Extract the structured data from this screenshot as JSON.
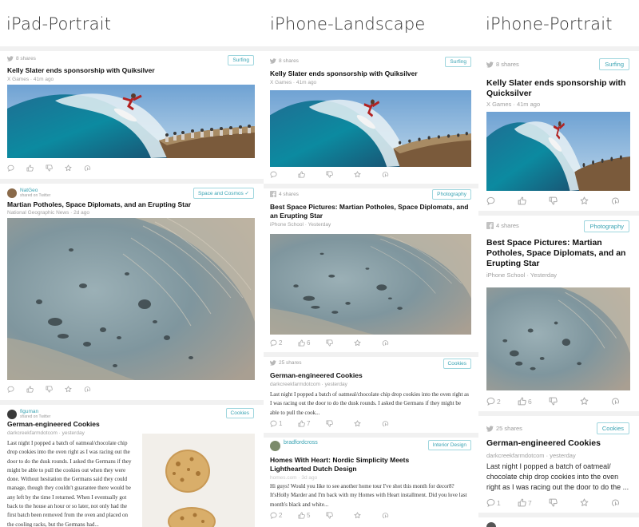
{
  "titles": {
    "ipad": "iPad-Portrait",
    "landscape": "iPhone-Landscape",
    "portrait": "iPhone-Portrait"
  },
  "ipad": {
    "card1": {
      "shares": "8 shares",
      "tag": "Surfing",
      "headline": "Kelly Slater ends sponsorship with Quiksilver",
      "source": "X Games",
      "time": "41m ago"
    },
    "card2": {
      "user": "NatGeo",
      "user_sub": "shared on Twitter",
      "tag": "Space and Cosmos",
      "headline": "Martian Potholes, Space Diplomats, and an Erupting Star",
      "source": "National Geographic News",
      "time": "2d ago"
    },
    "card3": {
      "user": "figuman",
      "user_sub": "shared on Twitter",
      "tag": "Cookies",
      "headline": "German-engineered Cookies",
      "source": "darkcreekfarmdotcom",
      "time": "yesterday",
      "excerpt": "Last night I popped a batch of oatmeal/chocolate chip drop cookies into the oven right as I was racing out the door to do the dusk rounds. I asked the Germans if they might be able to pull the cookies out when they were done. Without hesitation the Germans said they could manage, though they couldn't guarantee there would be any left by the time I returned. When I eventually got back to the house an hour or so later, not only had the first batch been removed from the oven and placed on the cooling racks, but the Germans had..."
    }
  },
  "landscape": {
    "card1": {
      "shares": "8 shares",
      "tag": "Surfing",
      "headline": "Kelly Slater ends sponsorship with Quiksilver",
      "source": "X Games",
      "time": "41m ago"
    },
    "card2": {
      "shares": "4 shares",
      "tag": "Photography",
      "headline": "Best Space Pictures: Martian Potholes, Space Diplomats, and an Erupting Star",
      "source": "iPhone School",
      "time": "Yesterday",
      "comments": "2",
      "likes": "6"
    },
    "card3": {
      "shares": "25 shares",
      "tag": "Cookies",
      "headline": "German-engineered Cookies",
      "source": "darkcreekfarmdotcom",
      "time": "yesterday",
      "excerpt": "Last night I popped a batch of oatmeal/chocolate chip drop cookies into the oven right as I was racing out the door to do the dusk rounds. I asked the Germans if they might be able to pull the cook...",
      "comments": "1",
      "likes": "7"
    },
    "card4": {
      "user": "bradfordcross",
      "tag": "Interior Design",
      "headline": "Homes With Heart: Nordic Simplicity Meets Lighthearted Dutch Design",
      "source": "homes.com",
      "time": "3d ago",
      "excerpt": "Hi guys! Would you like to see another home tour I've shot this month for decor8? It'sHolly Marder and I'm back with my Homes with Heart installment. Did you love last month's black and white...",
      "comments": "2",
      "likes": "5"
    }
  },
  "portrait": {
    "card1": {
      "shares": "8 shares",
      "tag": "Surfing",
      "headline": "Kelly Slater ends sponsorship with Quicksilver",
      "source": "X Games",
      "time": "41m ago"
    },
    "card2": {
      "shares": "4 shares",
      "tag": "Photography",
      "headline": "Best Space Pictures: Martian Potholes, Space Diplomats, and an Erupting Star",
      "source": "iPhone School",
      "time": "Yesterday",
      "comments": "2",
      "likes": "6"
    },
    "card3": {
      "shares": "25 shares",
      "tag": "Cookies",
      "headline": "German-engineered Cookies",
      "source": "darkcreekfarmdotcom",
      "time": "yesterday",
      "excerpt": "Last night I popped a batch of oatmeal/ chocolate chip drop cookies into the oven right as I was racing out the door to do the ...",
      "comments": "1",
      "likes": "7"
    }
  },
  "colors": {
    "tag_border": "#9fd6de",
    "tag_text": "#39a3b3",
    "separator": "#f1f1f1",
    "meta": "#9a9a9a"
  },
  "icons": [
    "twitter-bird-icon",
    "facebook-icon",
    "comment-icon",
    "thumbs-up-icon",
    "thumbs-down-icon",
    "star-icon",
    "share-icon"
  ]
}
